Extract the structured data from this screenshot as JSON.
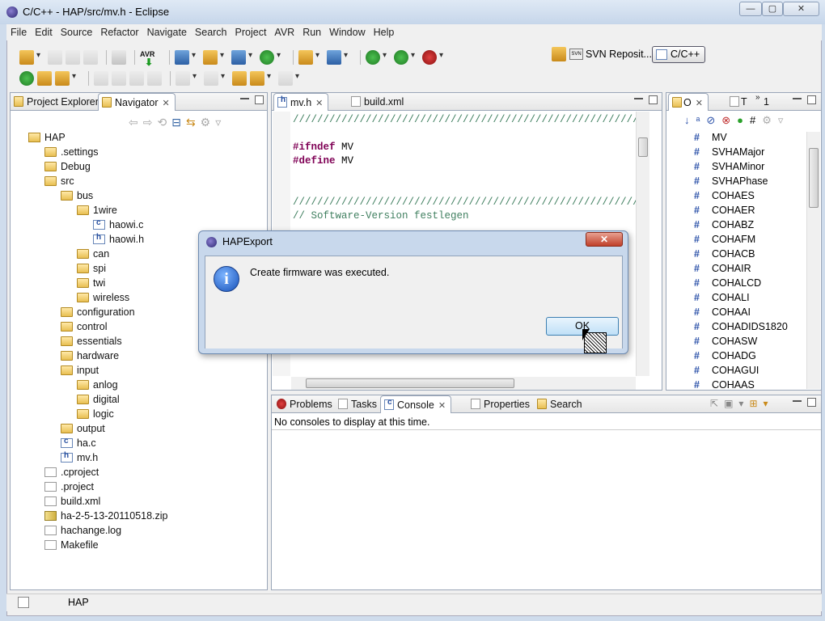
{
  "window": {
    "title": "C/C++ - HAP/src/mv.h - Eclipse"
  },
  "menu": [
    "File",
    "Edit",
    "Source",
    "Refactor",
    "Navigate",
    "Search",
    "Project",
    "AVR",
    "Run",
    "Window",
    "Help"
  ],
  "perspectives": {
    "svn": "SVN Reposit...",
    "cpp": "C/C++"
  },
  "left_panel": {
    "tabs": [
      "Project Explorer",
      "Navigator"
    ],
    "tree": [
      {
        "label": "HAP",
        "type": "proj",
        "depth": 0
      },
      {
        "label": ".settings",
        "type": "folder",
        "depth": 1
      },
      {
        "label": "Debug",
        "type": "folder",
        "depth": 1
      },
      {
        "label": "src",
        "type": "folder",
        "depth": 1
      },
      {
        "label": "bus",
        "type": "folder",
        "depth": 2
      },
      {
        "label": "1wire",
        "type": "folder",
        "depth": 3
      },
      {
        "label": "haowi.c",
        "type": "cfile",
        "depth": 4
      },
      {
        "label": "haowi.h",
        "type": "hfile",
        "depth": 4
      },
      {
        "label": "can",
        "type": "folder",
        "depth": 3
      },
      {
        "label": "spi",
        "type": "folder",
        "depth": 3
      },
      {
        "label": "twi",
        "type": "folder",
        "depth": 3
      },
      {
        "label": "wireless",
        "type": "folder",
        "depth": 3
      },
      {
        "label": "configuration",
        "type": "folder",
        "depth": 2
      },
      {
        "label": "control",
        "type": "folder",
        "depth": 2
      },
      {
        "label": "essentials",
        "type": "folder",
        "depth": 2
      },
      {
        "label": "hardware",
        "type": "folder",
        "depth": 2
      },
      {
        "label": "input",
        "type": "folder",
        "depth": 2
      },
      {
        "label": "anlog",
        "type": "folder",
        "depth": 3
      },
      {
        "label": "digital",
        "type": "folder",
        "depth": 3
      },
      {
        "label": "logic",
        "type": "folder",
        "depth": 3
      },
      {
        "label": "output",
        "type": "folder",
        "depth": 2
      },
      {
        "label": "ha.c",
        "type": "cfile",
        "depth": 2
      },
      {
        "label": "mv.h",
        "type": "hfile",
        "depth": 2
      },
      {
        "label": ".cproject",
        "type": "gfile",
        "depth": 1
      },
      {
        "label": ".project",
        "type": "gfile",
        "depth": 1
      },
      {
        "label": "build.xml",
        "type": "gfile",
        "depth": 1
      },
      {
        "label": "ha-2-5-13-20110518.zip",
        "type": "zfile",
        "depth": 1
      },
      {
        "label": "hachange.log",
        "type": "gfile",
        "depth": 1
      },
      {
        "label": "Makefile",
        "type": "gfile",
        "depth": 1
      }
    ]
  },
  "editor": {
    "tabs": [
      "mv.h",
      "build.xml"
    ],
    "lines": [
      {
        "cls": "comment",
        "text": "///////////////////////////////////////////////////////////"
      },
      {
        "cls": "blank",
        "text": ""
      },
      {
        "cls": "pre",
        "kw": "#ifndef",
        "rest": " MV"
      },
      {
        "cls": "pre",
        "kw": "#define",
        "rest": " MV"
      },
      {
        "cls": "blank",
        "text": ""
      },
      {
        "cls": "blank",
        "text": ""
      },
      {
        "cls": "comment",
        "text": "///////////////////////////////////////////////////////////"
      },
      {
        "cls": "comment",
        "text": "// Software-Version festlegen"
      }
    ]
  },
  "outline": {
    "tabs": [
      "O",
      "T",
      "1"
    ],
    "items": [
      "MV",
      "SVHAMajor",
      "SVHAMinor",
      "SVHAPhase",
      "COHAES",
      "COHAER",
      "COHABZ",
      "COHAFM",
      "COHACB",
      "COHAIR",
      "COHALCD",
      "COHALI",
      "COHAAI",
      "COHADIDS1820",
      "COHASW",
      "COHADG",
      "COHAGUI",
      "COHAAS"
    ]
  },
  "bottom": {
    "tabs": [
      "Problems",
      "Tasks",
      "Console",
      "Properties",
      "Search"
    ],
    "message": "No consoles to display at this time."
  },
  "dialog": {
    "title": "HAPExport",
    "message": "Create firmware was executed.",
    "ok": "OK"
  },
  "status": {
    "text": "HAP"
  }
}
